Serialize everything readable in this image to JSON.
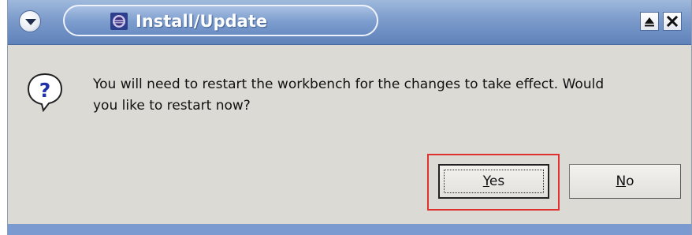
{
  "window": {
    "title": "Install/Update"
  },
  "dialog": {
    "message_line1": "You will need to restart the workbench for the changes to take effect. Would",
    "message_line2": "you like to restart now?",
    "icon": "question-icon"
  },
  "buttons": {
    "yes_mnemonic": "Y",
    "yes_rest": "es",
    "no_mnemonic": "N",
    "no_rest": "o"
  },
  "colors": {
    "titlebar": "#7c9bcb",
    "dialog_bg": "#dcdad5",
    "highlight": "#e03030"
  }
}
